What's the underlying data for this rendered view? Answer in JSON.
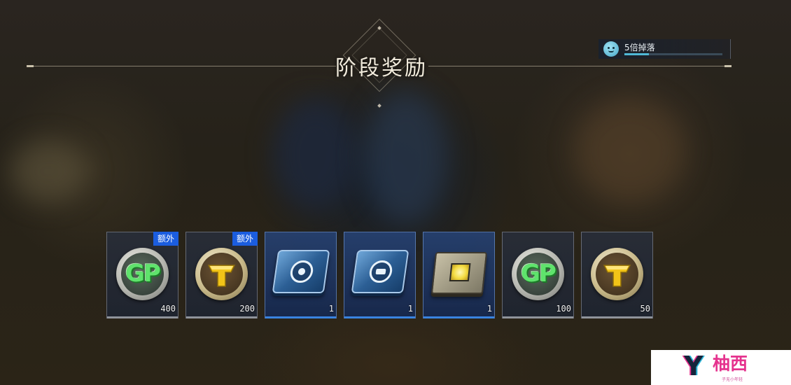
{
  "header": {
    "title": "阶段奖励"
  },
  "bonus": {
    "label": "5倍掉落",
    "icon": "smiley-face-icon",
    "progress": 0.25,
    "color": "#4fb8d6"
  },
  "rewards": [
    {
      "icon": "gp-coin-icon",
      "quantity": "400",
      "badge": "额外",
      "rarity": "common"
    },
    {
      "icon": "gold-t-coin-icon",
      "quantity": "200",
      "badge": "额外",
      "rarity": "common"
    },
    {
      "icon": "blue-chip-target-icon",
      "quantity": "1",
      "badge": "",
      "rarity": "rare"
    },
    {
      "icon": "blue-chip-battery-icon",
      "quantity": "1",
      "badge": "",
      "rarity": "rare"
    },
    {
      "icon": "yellow-circuit-board-icon",
      "quantity": "1",
      "badge": "",
      "rarity": "rare"
    },
    {
      "icon": "gp-coin-icon",
      "quantity": "100",
      "badge": "",
      "rarity": "common"
    },
    {
      "icon": "gold-t-coin-icon",
      "quantity": "50",
      "badge": "",
      "rarity": "common"
    }
  ],
  "colors": {
    "badge": "#1b5ddf",
    "rare_bar": "#3a84e0",
    "common_bar": "#8f949b"
  },
  "watermark": {
    "logo": "Y",
    "name": "柚西",
    "sub": "子无小年轻"
  }
}
